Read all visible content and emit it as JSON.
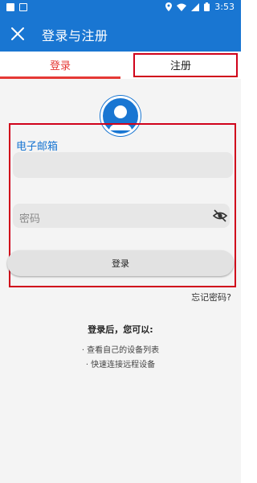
{
  "status_bar": {
    "time": "3:53",
    "icon_names": [
      "notification-icon",
      "a-icon",
      "location-icon",
      "wifi-icon",
      "signal-icon",
      "battery-icon"
    ]
  },
  "app_bar": {
    "title": "登录与注册",
    "close_icon": "close-icon"
  },
  "tabs": [
    {
      "label": "登录",
      "active": true
    },
    {
      "label": "注册",
      "active": false
    }
  ],
  "form": {
    "email_label": "电子邮箱",
    "email_value": "",
    "password_placeholder": "密码",
    "password_value": "",
    "login_button": "登录",
    "forgot_password": "忘记密码?"
  },
  "info": {
    "title": "登录后，您可以:",
    "items": [
      "· 查看自己的设备列表",
      "· 快速连接远程设备"
    ]
  },
  "colors": {
    "primary": "#1976d2",
    "accent": "#e53935",
    "highlight": "#d0021b",
    "background": "#f4f4f4"
  }
}
